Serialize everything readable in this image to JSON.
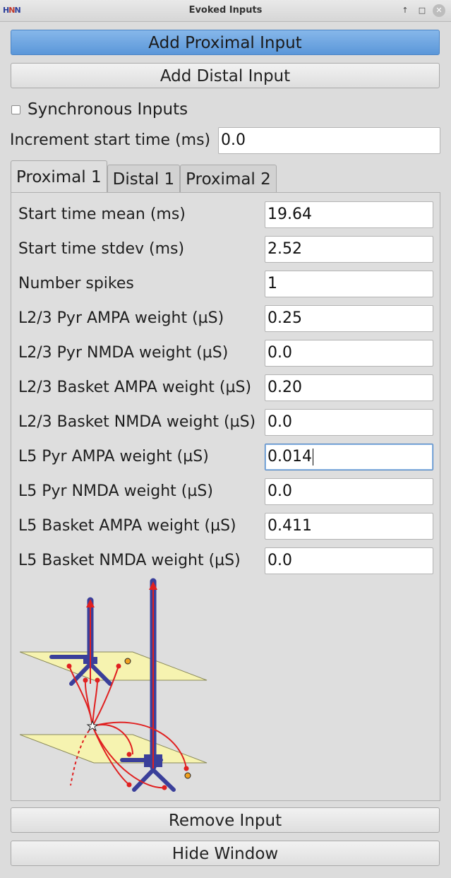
{
  "window": {
    "title": "Evoked Inputs",
    "logo": "HNN"
  },
  "buttons": {
    "add_proximal": "Add Proximal Input",
    "add_distal": "Add Distal Input",
    "remove_input": "Remove Input",
    "hide_window": "Hide Window"
  },
  "sync": {
    "label": "Synchronous Inputs",
    "checked": false
  },
  "increment": {
    "label": "Increment start time (ms)",
    "value": "0.0"
  },
  "tabs": [
    {
      "label": "Proximal 1",
      "active": true
    },
    {
      "label": "Distal 1",
      "active": false
    },
    {
      "label": "Proximal 2",
      "active": false
    }
  ],
  "params": [
    {
      "label": "Start time mean (ms)",
      "value": "19.64"
    },
    {
      "label": "Start time stdev (ms)",
      "value": "2.52"
    },
    {
      "label": "Number spikes",
      "value": "1"
    },
    {
      "label": "L2/3 Pyr AMPA weight (µS)",
      "value": "0.25"
    },
    {
      "label": "L2/3 Pyr NMDA weight (µS)",
      "value": "0.0"
    },
    {
      "label": "L2/3 Basket AMPA weight (µS)",
      "value": "0.20"
    },
    {
      "label": "L2/3 Basket NMDA weight (µS)",
      "value": "0.0"
    },
    {
      "label": "L5 Pyr AMPA weight (µS)",
      "value": "0.014"
    },
    {
      "label": "L5 Pyr NMDA weight (µS)",
      "value": "0.0"
    },
    {
      "label": "L5 Basket AMPA weight (µS)",
      "value": "0.411"
    },
    {
      "label": "L5 Basket NMDA weight (µS)",
      "value": "0.0"
    }
  ],
  "colors": {
    "accent": "#5b97d9",
    "neuron": "#3a3f9a",
    "input_line": "#e02020",
    "layer_plane": "#f6f3b0",
    "basket_cell": "#f0a020"
  },
  "icons": {
    "maximize": "up-arrow-icon",
    "restore": "square-icon",
    "close": "x-icon"
  }
}
